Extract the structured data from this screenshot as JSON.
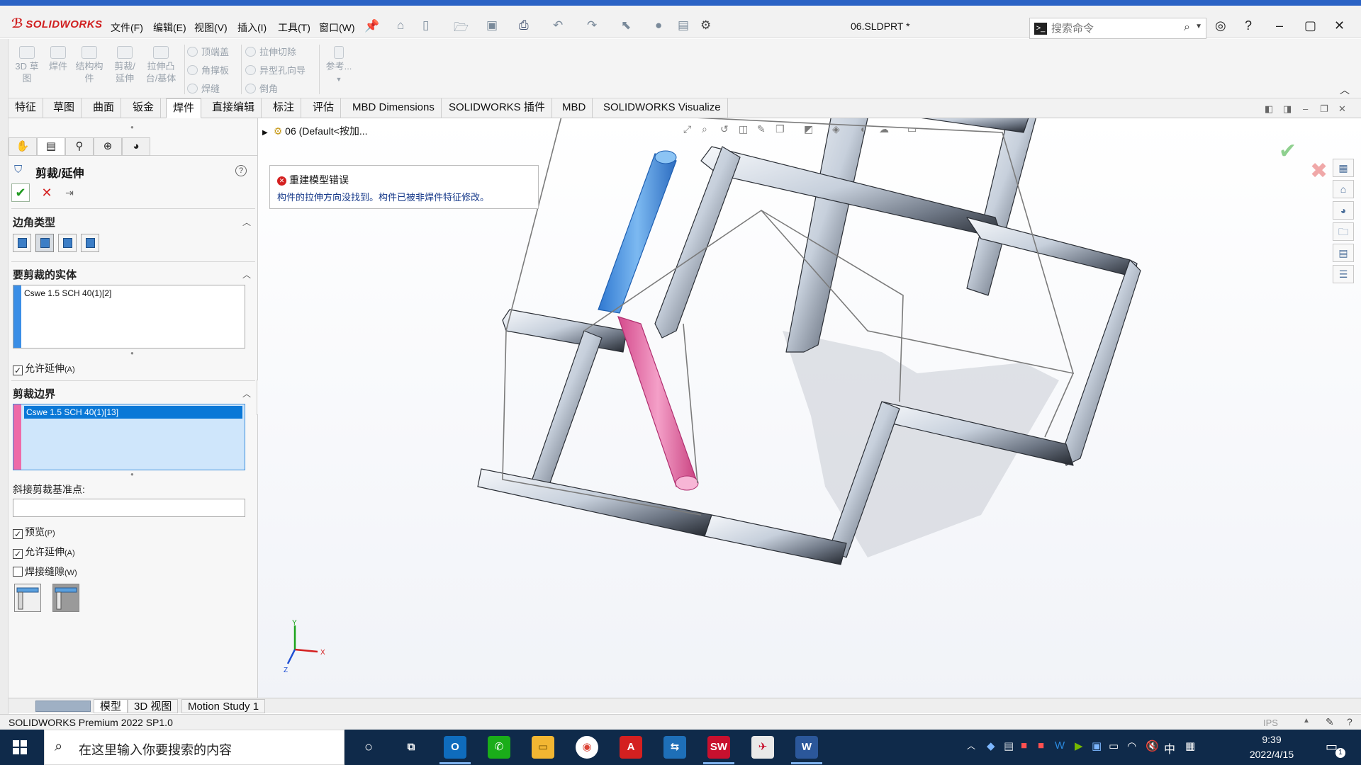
{
  "app": {
    "logo_text": "SOLIDWORKS",
    "document_title": "06.SLDPRT *"
  },
  "menu": [
    "文件(F)",
    "编辑(E)",
    "视图(V)",
    "插入(I)",
    "工具(T)",
    "窗口(W)"
  ],
  "search": {
    "placeholder": "搜索命令"
  },
  "ribbon": {
    "large": [
      {
        "label": "3D 草图",
        "lines": [
          "3D 草",
          "图"
        ]
      },
      {
        "label": "焊件",
        "lines": [
          "焊件"
        ]
      },
      {
        "label": "结构构件",
        "lines": [
          "结构构",
          "件"
        ]
      },
      {
        "label": "剪裁/延伸",
        "lines": [
          "剪裁/",
          "延伸"
        ]
      },
      {
        "label": "拉伸凸台/基体",
        "lines": [
          "拉伸凸",
          "台/基体"
        ]
      }
    ],
    "small_col1": [
      "顶端盖",
      "角撑板",
      "焊缝"
    ],
    "small_col2": [
      "拉伸切除",
      "异型孔向导",
      "倒角"
    ],
    "ref": "参考..."
  },
  "command_tabs": [
    "特征",
    "草图",
    "曲面",
    "钣金",
    "焊件",
    "直接编辑",
    "标注",
    "评估",
    "MBD Dimensions",
    "SOLIDWORKS 插件",
    "MBD",
    "SOLIDWORKS Visualize"
  ],
  "active_tab": "焊件",
  "property_manager": {
    "title": "剪裁/延伸",
    "help": "?",
    "corner_type": {
      "title": "边角类型"
    },
    "bodies_to_trim": {
      "title": "要剪裁的实体",
      "items": [
        "Cswe 1.5 SCH 40(1)[2]"
      ],
      "color": "#3a8ee6",
      "allow_extend": "允许延伸",
      "allow_extend_shortcut": "(A)",
      "allow_extend_checked": "✓"
    },
    "trim_boundary": {
      "title": "剪裁边界",
      "items": [
        "Cswe 1.5 SCH 40(1)[13]"
      ],
      "color": "#ee6aa8",
      "miter_label": "斜接剪裁基准点:",
      "preview": "预览",
      "preview_shortcut": "(P)",
      "preview_checked": "✓",
      "allow_extend": "允许延伸",
      "allow_extend_shortcut": "(A)",
      "allow_extend_checked": "✓",
      "weld_gap": "焊接缝隙",
      "weld_gap_shortcut": "(W)"
    }
  },
  "tree": {
    "root_label": "06 (Default<按加..."
  },
  "error": {
    "title": "重建模型错误",
    "message": "构件的拉伸方向没找到。构件已被非焊件特征修改。"
  },
  "triad": {
    "x": "X",
    "y": "Y",
    "z": "Z"
  },
  "model_tabs": [
    "模型",
    "3D 视图",
    "Motion Study 1"
  ],
  "status": {
    "text": "SOLIDWORKS Premium 2022 SP1.0",
    "units": "IPS"
  },
  "taskbar": {
    "search_placeholder": "在这里输入你要搜索的内容",
    "time": "9:39",
    "date": "2022/4/15",
    "ime": "中",
    "notifications": "1"
  },
  "colors": {
    "selection_blue": "#3a8ee6",
    "selection_pink": "#ee6aa8",
    "accent": "#0a78d7",
    "error_red": "#d42020"
  }
}
